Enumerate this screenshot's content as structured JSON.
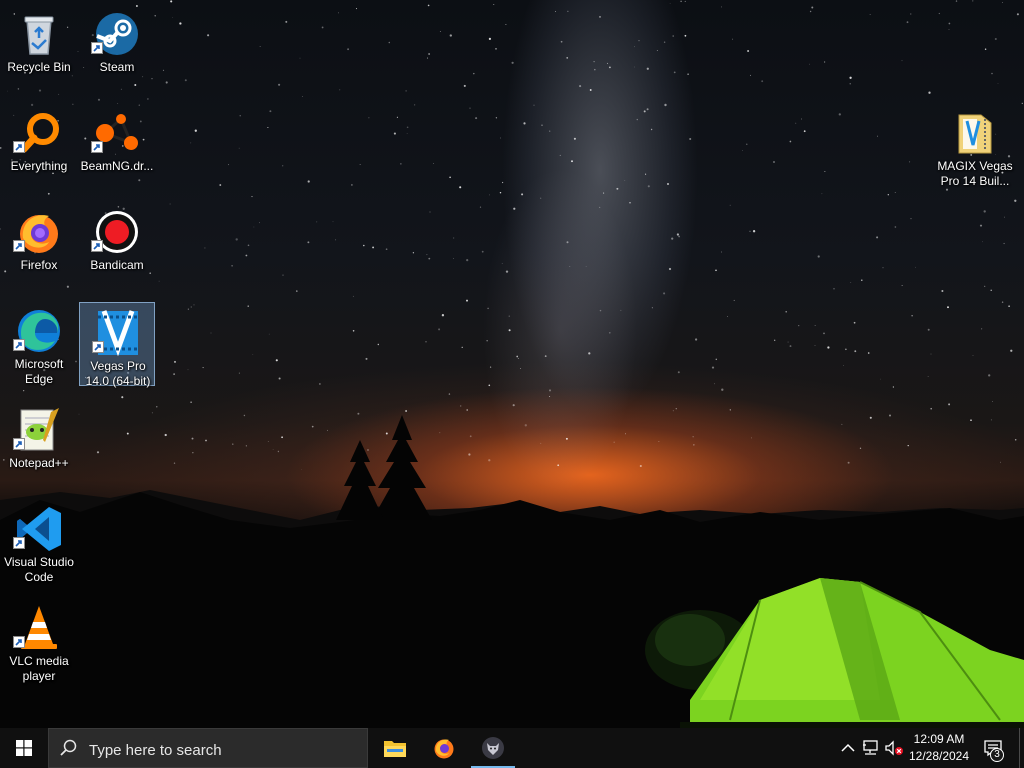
{
  "desktop": {
    "icons": [
      {
        "id": "recycle-bin",
        "label": "Recycle Bin",
        "icon": "recycle-bin-icon",
        "shortcut": false
      },
      {
        "id": "steam",
        "label": "Steam",
        "icon": "steam-icon",
        "shortcut": true
      },
      {
        "id": "everything",
        "label": "Everything",
        "icon": "everything-search-icon",
        "shortcut": true
      },
      {
        "id": "beamng",
        "label": "BeamNG.dr...",
        "icon": "beamng-icon",
        "shortcut": true
      },
      {
        "id": "firefox",
        "label": "Firefox",
        "icon": "firefox-icon",
        "shortcut": true
      },
      {
        "id": "bandicam",
        "label": "Bandicam",
        "icon": "bandicam-record-icon",
        "shortcut": true
      },
      {
        "id": "edge",
        "label": "Microsoft\nEdge",
        "icon": "edge-icon",
        "shortcut": true
      },
      {
        "id": "vegas",
        "label": "Vegas Pro\n14.0 (64-bit)",
        "icon": "vegas-pro-icon",
        "shortcut": true,
        "selected": true
      },
      {
        "id": "notepadpp",
        "label": "Notepad++",
        "icon": "notepad-plus-plus-icon",
        "shortcut": true
      },
      {
        "id": "vscode",
        "label": "Visual Studio\nCode",
        "icon": "vscode-icon",
        "shortcut": true
      },
      {
        "id": "vlc",
        "label": "VLC media\nplayer",
        "icon": "vlc-cone-icon",
        "shortcut": true
      },
      {
        "id": "magix-folder",
        "label": "MAGIX Vegas\nPro 14 Buil...",
        "icon": "zip-folder-icon",
        "shortcut": false
      }
    ]
  },
  "taskbar": {
    "search_placeholder": "Type here to search",
    "pinned": [
      {
        "id": "file-explorer",
        "icon": "file-explorer-icon"
      },
      {
        "id": "firefox",
        "icon": "firefox-icon"
      },
      {
        "id": "app-running",
        "icon": "app-wolf-icon",
        "active": true
      }
    ],
    "tray": {
      "time": "12:09 AM",
      "date": "12/28/2024",
      "notification_count": "3"
    }
  },
  "colors": {
    "taskbar_bg": "#101010",
    "search_bg": "#2b2b2b",
    "active_indicator": "#76b9ed",
    "selection": "#78aadc"
  }
}
